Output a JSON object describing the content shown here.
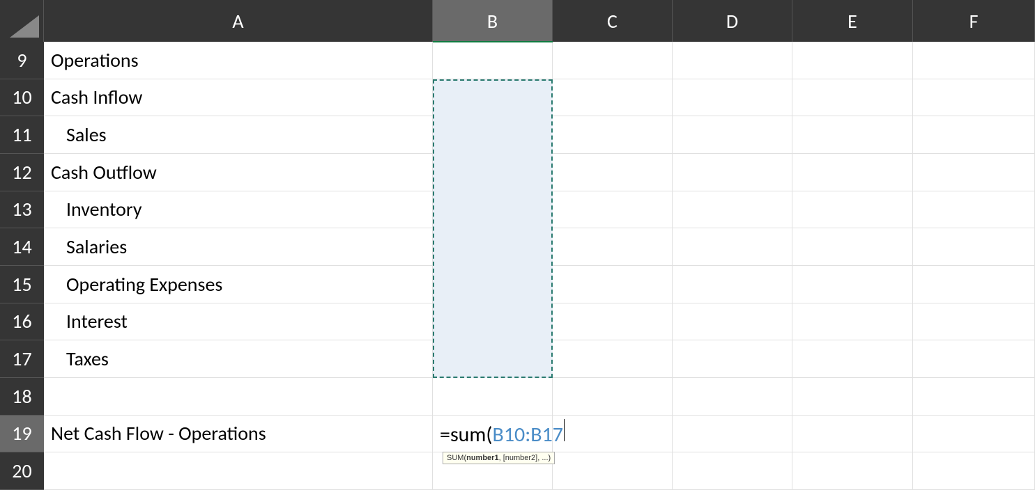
{
  "columns": [
    "A",
    "B",
    "C",
    "D",
    "E",
    "F"
  ],
  "rows": [
    "9",
    "10",
    "11",
    "12",
    "13",
    "14",
    "15",
    "16",
    "17",
    "18",
    "19",
    "20"
  ],
  "selectedCol": "B",
  "selectedRow": "19",
  "cells": {
    "A9": "Operations",
    "A10": "Cash Inflow",
    "A11": "Sales",
    "A12": "Cash Outflow",
    "A13": "Inventory",
    "A14": "Salaries",
    "A15": "Operating Expenses",
    "A16": "Interest",
    "A17": "Taxes",
    "A19": "Net Cash Flow - Operations"
  },
  "formula": {
    "prefix": "=sum(",
    "reference": "B10:B17"
  },
  "tooltip": {
    "fn": "SUM(",
    "bold": "number1",
    "rest": ", [number2], ...)"
  },
  "selectionRange": "B10:B17",
  "activeCell": "B19"
}
